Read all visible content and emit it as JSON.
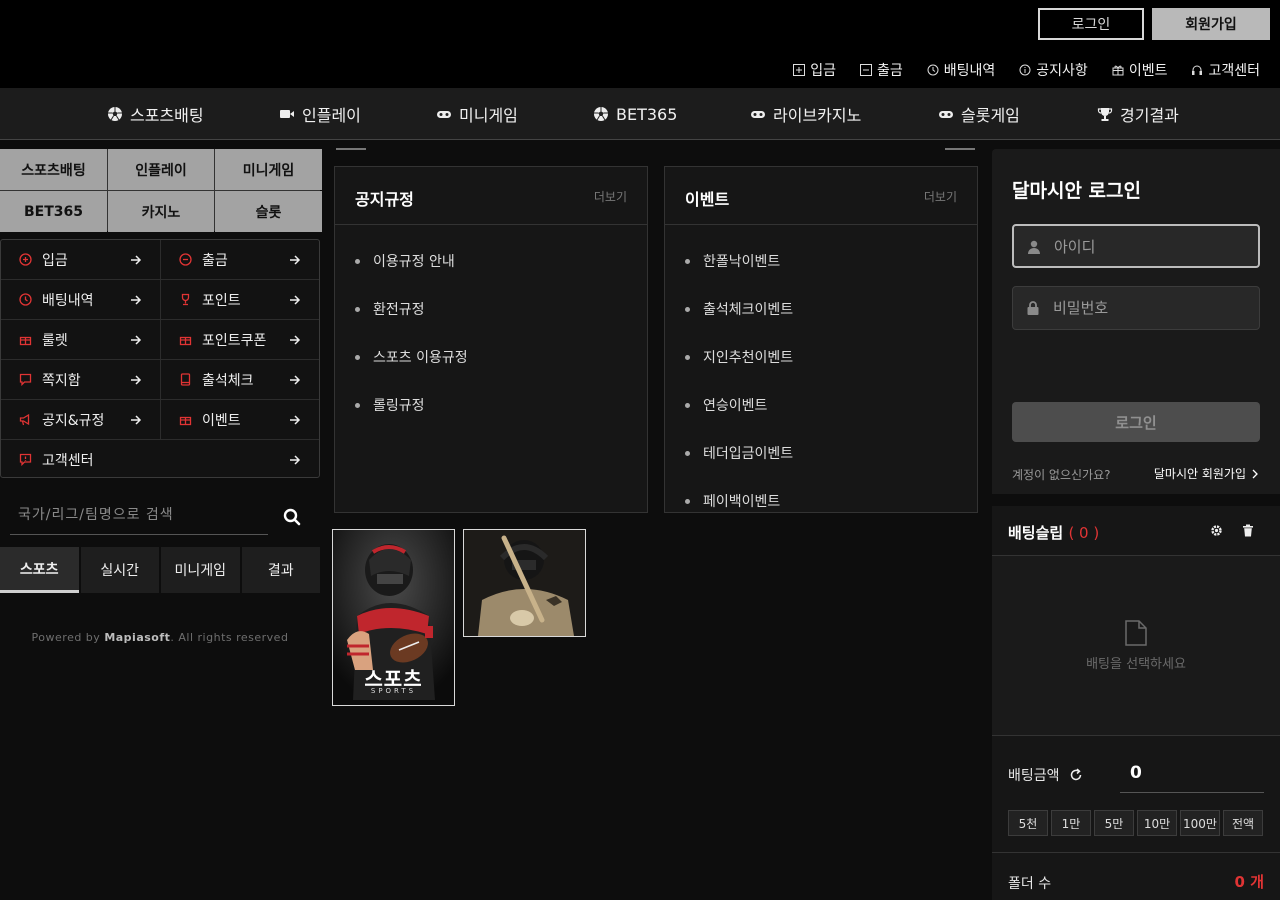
{
  "header": {
    "login_label": "로그인",
    "join_label": "회원가입",
    "util_links": [
      {
        "label": "입금",
        "icon": "plus-square-icon"
      },
      {
        "label": "출금",
        "icon": "minus-square-icon"
      },
      {
        "label": "배팅내역",
        "icon": "history-icon"
      },
      {
        "label": "공지사항",
        "icon": "info-icon"
      },
      {
        "label": "이벤트",
        "icon": "gift-icon"
      },
      {
        "label": "고객센터",
        "icon": "headset-icon"
      }
    ]
  },
  "main_nav": [
    {
      "label": "스포츠배팅",
      "icon": "soccer-ball-icon"
    },
    {
      "label": "인플레이",
      "icon": "video-camera-icon"
    },
    {
      "label": "미니게임",
      "icon": "gamepad-icon"
    },
    {
      "label": "BET365",
      "icon": "soccer-ball-icon"
    },
    {
      "label": "라이브카지노",
      "icon": "gamepad-icon"
    },
    {
      "label": "슬롯게임",
      "icon": "gamepad-icon"
    },
    {
      "label": "경기결과",
      "icon": "trophy-icon"
    }
  ],
  "category_grid": [
    "스포츠배팅",
    "인플레이",
    "미니게임",
    "BET365",
    "카지노",
    "슬롯"
  ],
  "side_menu": [
    {
      "label": "입금",
      "icon": "plus-circle-icon"
    },
    {
      "label": "출금",
      "icon": "minus-circle-icon"
    },
    {
      "label": "배팅내역",
      "icon": "history-icon"
    },
    {
      "label": "포인트",
      "icon": "trophy-icon"
    },
    {
      "label": "룰렛",
      "icon": "gift-icon"
    },
    {
      "label": "포인트쿠폰",
      "icon": "gift-icon"
    },
    {
      "label": "쪽지함",
      "icon": "message-icon"
    },
    {
      "label": "출석체크",
      "icon": "book-icon"
    },
    {
      "label": "공지&규정",
      "icon": "megaphone-icon"
    },
    {
      "label": "이벤트",
      "icon": "gift-icon"
    },
    {
      "label": "고객센터",
      "icon": "chat-alert-icon"
    }
  ],
  "search": {
    "placeholder": "국가/리그/팀명으로 검색"
  },
  "sport_tabs": [
    "스포츠",
    "실시간",
    "미니게임",
    "결과"
  ],
  "footer": {
    "powered_prefix": "Powered by ",
    "brand": "Mapiasoft",
    "suffix": ". All rights reserved"
  },
  "notice_panel": {
    "title": "공지규정",
    "more": "더보기",
    "items": [
      "이용규정 안내",
      "환전규정",
      "스포츠 이용규정",
      "롤링규정"
    ]
  },
  "event_panel": {
    "title": "이벤트",
    "more": "더보기",
    "items": [
      "한폴낙이벤트",
      "출석체크이벤트",
      "지인추천이벤트",
      "연승이벤트",
      "테더입금이벤트",
      "페이백이벤트"
    ]
  },
  "game_cards": [
    {
      "title": "스포츠",
      "subtitle": "SPORTS"
    },
    {
      "title": "",
      "subtitle": ""
    }
  ],
  "login_box": {
    "title": "달마시안 로그인",
    "id_placeholder": "아이디",
    "pw_placeholder": "비밀번호",
    "login_button": "로그인",
    "no_account": "계정이 없으신가요?",
    "join_link": "달마시안 회원가입"
  },
  "bet_slip": {
    "title": "배팅슬립",
    "count": "( 0 )",
    "empty_message": "배팅을 선택하세요",
    "amount_label": "배팅금액",
    "amount_value": "0",
    "chips": [
      "5천",
      "1만",
      "5만",
      "10만",
      "100만",
      "전액"
    ],
    "folder_label": "폴더 수",
    "folder_value": "0 개"
  },
  "colors": {
    "accent_red": "#e03434",
    "nav_bg": "#1c1c1c",
    "page_bg": "#0d0d0d"
  }
}
